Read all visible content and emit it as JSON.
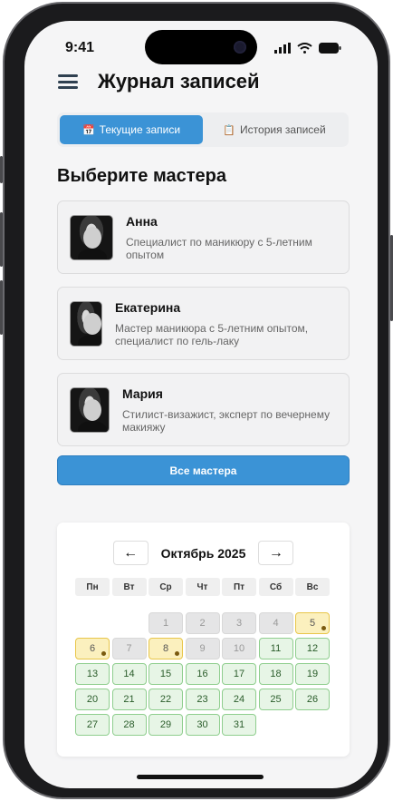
{
  "status": {
    "time": "9:41"
  },
  "header": {
    "title": "Журнал записей"
  },
  "tabs": [
    {
      "label": "Текущие записи",
      "icon": "calendar-icon"
    },
    {
      "label": "История записей",
      "icon": "clipboard-icon"
    }
  ],
  "section_title": "Выберите мастера",
  "masters": [
    {
      "name": "Анна",
      "desc": "Специалист по маникюру с 5-летним опытом"
    },
    {
      "name": "Екатерина",
      "desc": "Мастер маникюра с 5-летним опытом, специалист по гель-лаку"
    },
    {
      "name": "Мария",
      "desc": "Стилист-визажист, эксперт по вечернему макияжу"
    }
  ],
  "all_masters_label": "Все мастера",
  "calendar": {
    "prev": "←",
    "next": "→",
    "month": "Октябрь 2025",
    "weekdays": [
      "Пн",
      "Вт",
      "Ср",
      "Чт",
      "Пт",
      "Сб",
      "Вс"
    ],
    "days": [
      "1",
      "2",
      "3",
      "4",
      "5",
      "6",
      "7",
      "8",
      "9",
      "10",
      "11",
      "12",
      "13",
      "14",
      "15",
      "16",
      "17",
      "18",
      "19",
      "20",
      "21",
      "22",
      "23",
      "24",
      "25",
      "26",
      "27",
      "28",
      "29",
      "30",
      "31"
    ]
  },
  "colors": {
    "accent": "#3b93d6",
    "available": "#e7f5e6",
    "marked": "#fbf0be",
    "past": "#e5e5e6"
  }
}
